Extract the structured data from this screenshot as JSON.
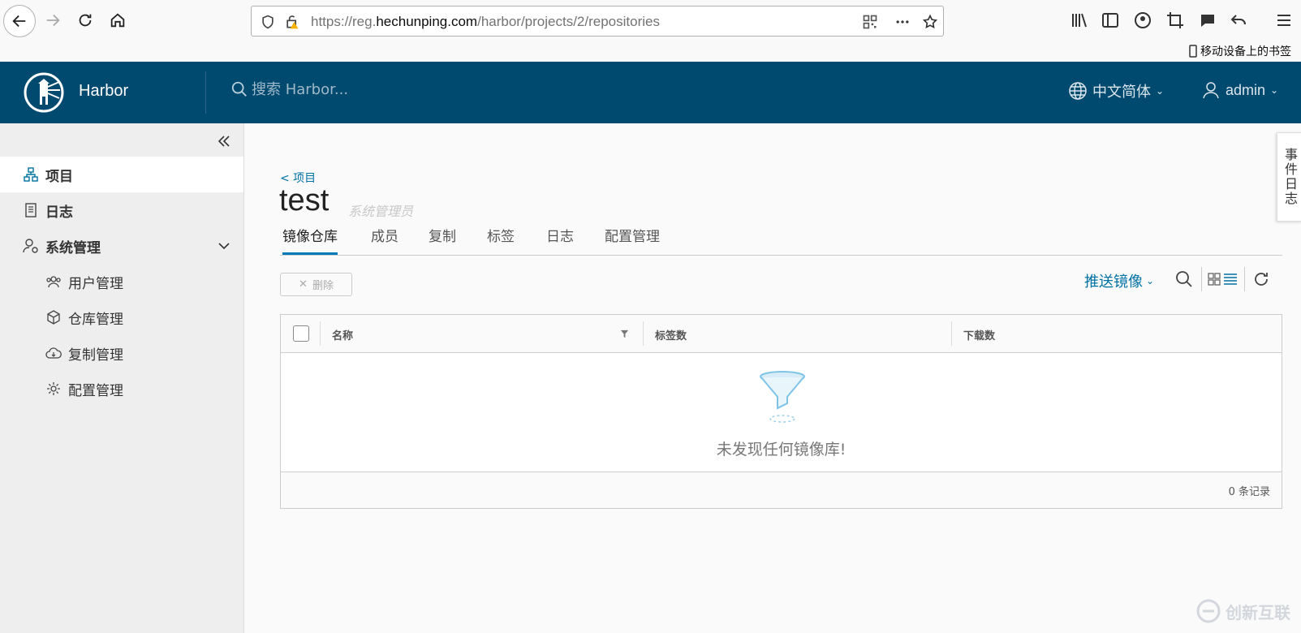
{
  "browser": {
    "url_prefix": "https://reg.",
    "url_domain": "hechunping.com",
    "url_path": "/harbor/projects/2/repositories",
    "mobile_bookmarks": "移动设备上的书签"
  },
  "header": {
    "brand": "Harbor",
    "search_placeholder": "搜索 Harbor...",
    "language": "中文简体",
    "user": "admin"
  },
  "sidebar": {
    "items": [
      {
        "label": "项目"
      },
      {
        "label": "日志"
      },
      {
        "label": "系统管理"
      }
    ],
    "sub_items": [
      {
        "label": "用户管理"
      },
      {
        "label": "仓库管理"
      },
      {
        "label": "复制管理"
      },
      {
        "label": "配置管理"
      }
    ]
  },
  "project": {
    "breadcrumb": "< 项目",
    "title": "test",
    "role": "系统管理员",
    "tabs": [
      {
        "label": "镜像仓库"
      },
      {
        "label": "成员"
      },
      {
        "label": "复制"
      },
      {
        "label": "标签"
      },
      {
        "label": "日志"
      },
      {
        "label": "配置管理"
      }
    ],
    "delete_label": "删除",
    "push_label": "推送镜像"
  },
  "grid": {
    "columns": [
      {
        "label": "名称"
      },
      {
        "label": "标签数"
      },
      {
        "label": "下载数"
      }
    ],
    "empty_text": "未发现任何镜像库!",
    "record_count": "0 条记录"
  },
  "event_log": "事件日志",
  "watermark": "创新互联",
  "colors": {
    "header_bg": "#004a70",
    "accent": "#0072a3",
    "tab_underline": "#0079b8"
  }
}
